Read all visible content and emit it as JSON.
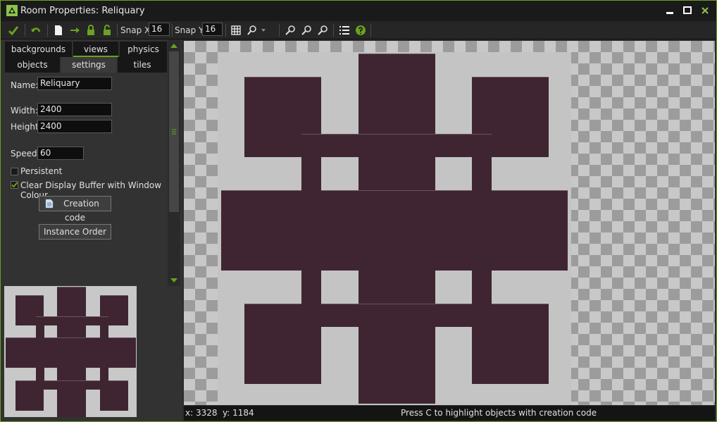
{
  "window": {
    "title": "Room Properties: Reliquary"
  },
  "toolbar": {
    "snap_x_label": "Snap X:",
    "snap_x_value": "16",
    "snap_y_label": "Snap Y:",
    "snap_y_value": "16"
  },
  "tabs": {
    "row1": [
      "backgrounds",
      "views",
      "physics"
    ],
    "row2": [
      "objects",
      "settings",
      "tiles"
    ]
  },
  "settings": {
    "name_label": "Name:",
    "name_value": "Reliquary",
    "width_label": "Width:",
    "width_value": "2400",
    "height_label": "Height:",
    "height_value": "2400",
    "speed_label": "Speed:",
    "speed_value": "60",
    "persistent_label": "Persistent",
    "persistent_checked": false,
    "clear_buffer_label": "Clear Display Buffer with Window Colour",
    "clear_buffer_checked": true,
    "creation_code_button": "Creation code",
    "instance_order_button": "Instance Order"
  },
  "status": {
    "x": "x: 3328",
    "y": "y: 1184",
    "message": "Press C to highlight objects with creation code"
  },
  "colors": {
    "accent": "#6aa21f",
    "room_fill": "#3f2532",
    "room_bg": "#c4c4c4"
  },
  "icons": [
    "app-logo-icon",
    "minimize-icon",
    "maximize-icon",
    "close-icon",
    "confirm-check-icon",
    "undo-icon",
    "new-page-icon",
    "shift-arrow-icon",
    "lock-icon",
    "unlock-icon",
    "grid-icon",
    "zoom-menu-icon",
    "zoom-out-icon",
    "zoom-reset-icon",
    "zoom-in-icon",
    "list-icon",
    "help-icon",
    "script-page-icon"
  ]
}
